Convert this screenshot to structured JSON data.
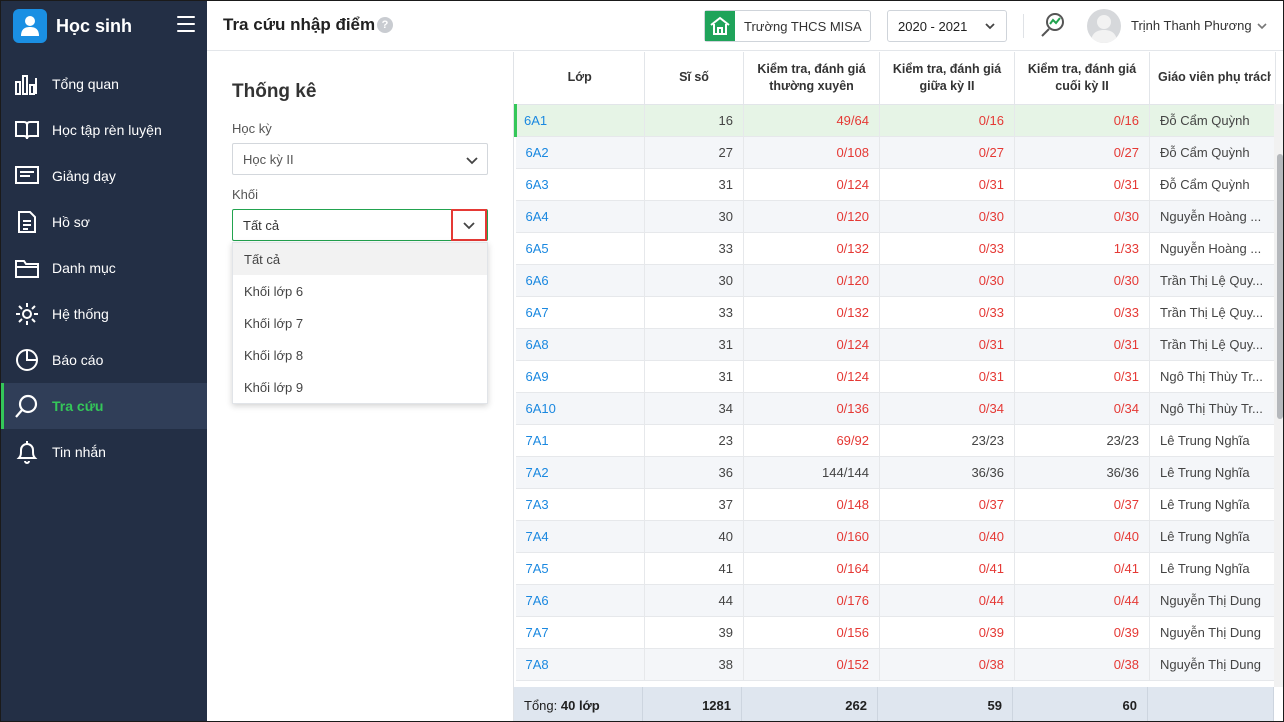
{
  "app": {
    "brand": "Học sinh"
  },
  "sidebar": {
    "items": [
      {
        "label": "Tổng quan",
        "icon": "bar-chart-icon"
      },
      {
        "label": "Học tập rèn luyện",
        "icon": "book-open-icon"
      },
      {
        "label": "Giảng dạy",
        "icon": "blackboard-icon"
      },
      {
        "label": "Hồ sơ",
        "icon": "document-icon"
      },
      {
        "label": "Danh mục",
        "icon": "folder-icon"
      },
      {
        "label": "Hệ thống",
        "icon": "gear-icon"
      },
      {
        "label": "Báo cáo",
        "icon": "pie-chart-icon"
      },
      {
        "label": "Tra cứu",
        "icon": "search-icon",
        "active": true
      },
      {
        "label": "Tin nhắn",
        "icon": "bell-icon"
      }
    ]
  },
  "header": {
    "title": "Tra cứu nhập điểm",
    "help": "?",
    "school": "Trường THCS MISA",
    "year": "2020 - 2021",
    "user": "Trịnh Thanh Phương"
  },
  "filters": {
    "title": "Thống kê",
    "semester_label": "Học kỳ",
    "semester_value": "Học kỳ II",
    "grade_label": "Khối",
    "grade_value": "Tất cả",
    "grade_options": [
      "Tất cả",
      "Khối lớp 6",
      "Khối lớp 7",
      "Khối lớp 8",
      "Khối lớp 9"
    ]
  },
  "table": {
    "headers": {
      "class": "Lớp",
      "size": "Sĩ số",
      "regular": "Kiểm tra, đánh giá thường xuyên",
      "midterm": "Kiểm tra, đánh giá giữa kỳ II",
      "final": "Kiểm tra, đánh giá cuối kỳ II",
      "teacher": "Giáo viên phụ trách"
    },
    "rows": [
      {
        "class": "6A1",
        "size": "16",
        "regular": "49/64",
        "midterm": "0/16",
        "final": "0/16",
        "teacher": "Đỗ Cẩm Quỳnh"
      },
      {
        "class": "6A2",
        "size": "27",
        "regular": "0/108",
        "midterm": "0/27",
        "final": "0/27",
        "teacher": "Đỗ Cẩm Quỳnh"
      },
      {
        "class": "6A3",
        "size": "31",
        "regular": "0/124",
        "midterm": "0/31",
        "final": "0/31",
        "teacher": "Đỗ Cẩm Quỳnh"
      },
      {
        "class": "6A4",
        "size": "30",
        "regular": "0/120",
        "midterm": "0/30",
        "final": "0/30",
        "teacher": "Nguyễn Hoàng ..."
      },
      {
        "class": "6A5",
        "size": "33",
        "regular": "0/132",
        "midterm": "0/33",
        "final": "1/33",
        "teacher": "Nguyễn Hoàng ..."
      },
      {
        "class": "6A6",
        "size": "30",
        "regular": "0/120",
        "midterm": "0/30",
        "final": "0/30",
        "teacher": "Trần Thị Lệ Quy..."
      },
      {
        "class": "6A7",
        "size": "33",
        "regular": "0/132",
        "midterm": "0/33",
        "final": "0/33",
        "teacher": "Trần Thị Lệ Quy..."
      },
      {
        "class": "6A8",
        "size": "31",
        "regular": "0/124",
        "midterm": "0/31",
        "final": "0/31",
        "teacher": "Trần Thị Lệ Quy..."
      },
      {
        "class": "6A9",
        "size": "31",
        "regular": "0/124",
        "midterm": "0/31",
        "final": "0/31",
        "teacher": "Ngô Thị Thùy Tr..."
      },
      {
        "class": "6A10",
        "size": "34",
        "regular": "0/136",
        "midterm": "0/34",
        "final": "0/34",
        "teacher": "Ngô Thị Thùy Tr..."
      },
      {
        "class": "7A1",
        "size": "23",
        "regular": "69/92",
        "midterm": "23/23",
        "final": "23/23",
        "teacher": "Lê Trung Nghĩa"
      },
      {
        "class": "7A2",
        "size": "36",
        "regular": "144/144",
        "midterm": "36/36",
        "final": "36/36",
        "teacher": "Lê Trung Nghĩa"
      },
      {
        "class": "7A3",
        "size": "37",
        "regular": "0/148",
        "midterm": "0/37",
        "final": "0/37",
        "teacher": "Lê Trung Nghĩa"
      },
      {
        "class": "7A4",
        "size": "40",
        "regular": "0/160",
        "midterm": "0/40",
        "final": "0/40",
        "teacher": "Lê Trung Nghĩa"
      },
      {
        "class": "7A5",
        "size": "41",
        "regular": "0/164",
        "midterm": "0/41",
        "final": "0/41",
        "teacher": "Lê Trung Nghĩa"
      },
      {
        "class": "7A6",
        "size": "44",
        "regular": "0/176",
        "midterm": "0/44",
        "final": "0/44",
        "teacher": "Nguyễn Thị Dung"
      },
      {
        "class": "7A7",
        "size": "39",
        "regular": "0/156",
        "midterm": "0/39",
        "final": "0/39",
        "teacher": "Nguyễn Thị Dung"
      },
      {
        "class": "7A8",
        "size": "38",
        "regular": "0/152",
        "midterm": "0/38",
        "final": "0/38",
        "teacher": "Nguyễn Thị Dung"
      }
    ],
    "footer": {
      "label": "Tổng:",
      "count": "40 lớp",
      "size": "1281",
      "regular": "262",
      "midterm": "59",
      "final": "60"
    }
  },
  "colors": {
    "sidebar_bg": "#232f45",
    "accent_green": "#34c759",
    "link_blue": "#1a88e0",
    "incomplete_red": "#e53935"
  }
}
